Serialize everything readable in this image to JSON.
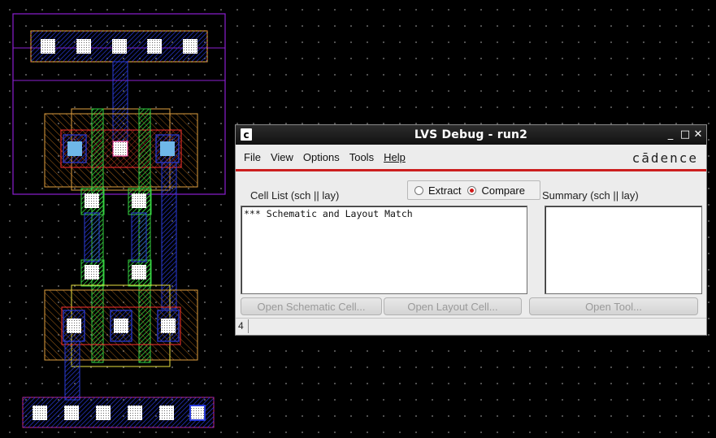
{
  "dialog": {
    "title": "LVS Debug - run2",
    "app_icon_glyph": "c",
    "window_controls": {
      "minimize": "_",
      "maximize": "□",
      "close": "✕"
    },
    "menus": [
      {
        "label": "File"
      },
      {
        "label": "View"
      },
      {
        "label": "Options"
      },
      {
        "label": "Tools"
      },
      {
        "label": "Help"
      }
    ],
    "brand": "cādence",
    "mode": {
      "options": [
        "Extract",
        "Compare"
      ],
      "selected": "Compare"
    },
    "cell_list": {
      "label": "Cell List (sch || lay)",
      "rows": [
        "*** Schematic and Layout Match"
      ]
    },
    "summary": {
      "label": "Summary (sch || lay)",
      "rows": []
    },
    "buttons": {
      "open_schematic": "Open Schematic Cell...",
      "open_layout": "Open Layout Cell...",
      "open_tool": "Open Tool..."
    },
    "status": {
      "count": "4"
    }
  },
  "layout_editor": {
    "background": "#000000",
    "colors": {
      "metal1": "#2a3bd8",
      "poly": "#35d040",
      "diffusion": "#e0a040",
      "nwell": "#8b1fd0",
      "contact": "#ffffff",
      "implant": "#ff3030"
    }
  }
}
